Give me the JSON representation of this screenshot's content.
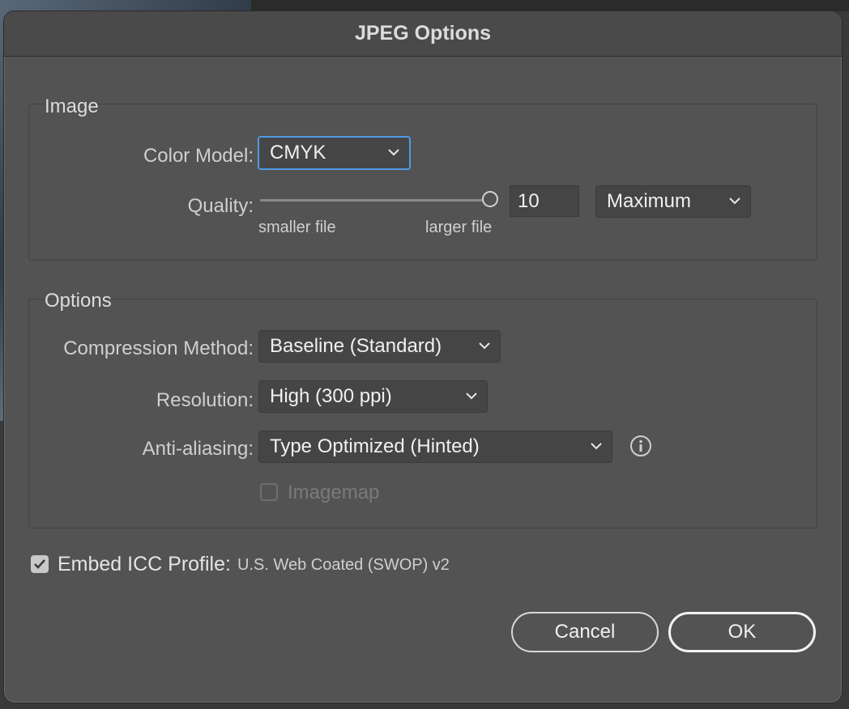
{
  "dialog": {
    "title": "JPEG Options"
  },
  "image_group": {
    "title": "Image",
    "color_model": {
      "label": "Color Model:",
      "value": "CMYK"
    },
    "quality": {
      "label": "Quality:",
      "value": "10",
      "fraction": 1.0,
      "min_label": "smaller file",
      "max_label": "larger file",
      "preset": "Maximum"
    }
  },
  "options_group": {
    "title": "Options",
    "compression": {
      "label": "Compression Method:",
      "value": "Baseline (Standard)"
    },
    "resolution": {
      "label": "Resolution:",
      "value": "High (300 ppi)"
    },
    "antialiasing": {
      "label": "Anti-aliasing:",
      "value": "Type Optimized (Hinted)"
    },
    "imagemap": {
      "label": "Imagemap",
      "checked": false,
      "enabled": false
    }
  },
  "icc": {
    "label": "Embed ICC Profile:",
    "value": "U.S. Web Coated (SWOP) v2",
    "checked": true
  },
  "buttons": {
    "cancel": "Cancel",
    "ok": "OK"
  },
  "icons": {
    "chevron": "chevron-down-icon",
    "info": "info-icon",
    "check": "checkmark-icon"
  }
}
